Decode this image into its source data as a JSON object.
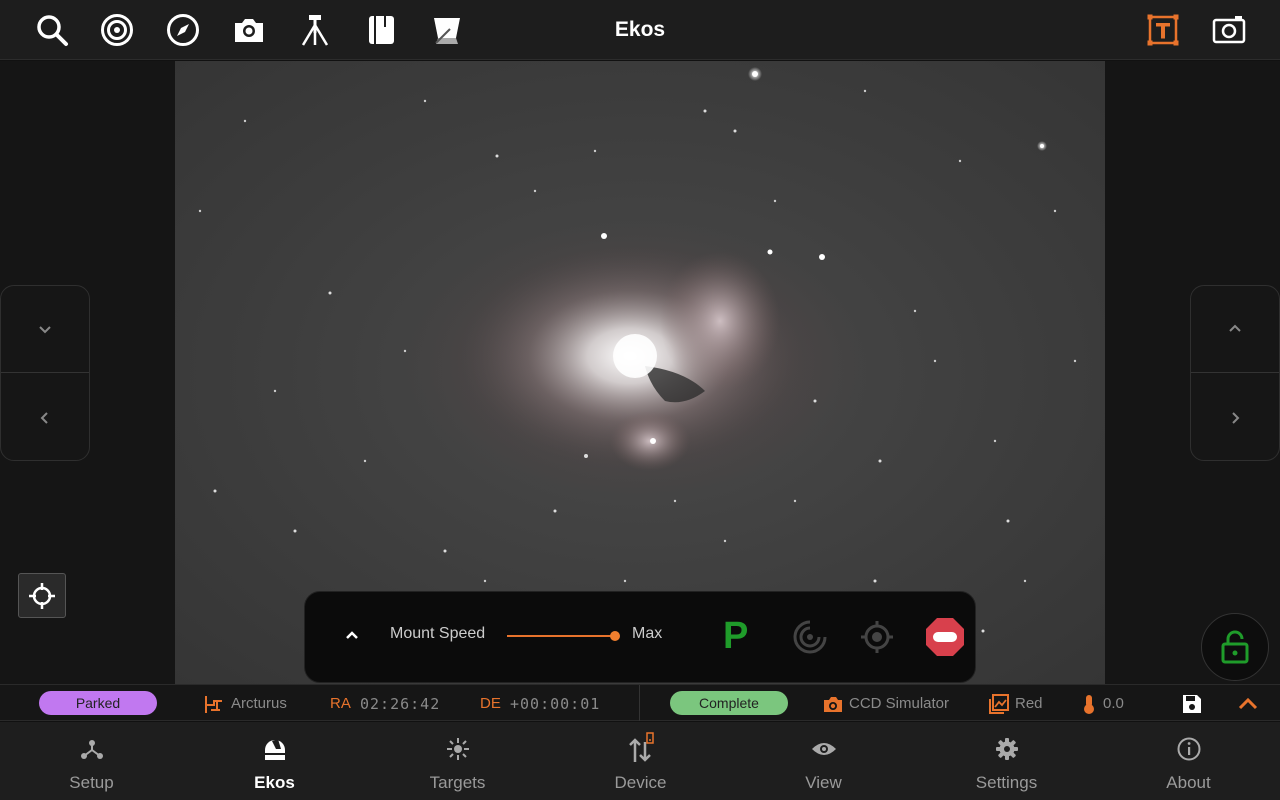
{
  "app": {
    "title": "Ekos"
  },
  "toolbar": {
    "icons": [
      "search-icon",
      "target-icon",
      "compass-icon",
      "camera-icon",
      "tripod-icon",
      "notebook-icon",
      "flat-field-icon",
      "text-overlay-icon",
      "screenshot-icon"
    ],
    "active_color": "#e8732c"
  },
  "mount_panel": {
    "label": "Mount Speed",
    "speed_value": "Max",
    "speed_fraction": 1.0,
    "park_label": "P",
    "park_color": "#1f9c2a",
    "stop_color": "#d8404c"
  },
  "status": {
    "mount_state": "Parked",
    "mount_state_color": "#c178f0",
    "target_name": "Arcturus",
    "ra_label": "RA",
    "ra_value": "02:26:42",
    "de_label": "DE",
    "de_value": "+00:00:01",
    "capture_state": "Complete",
    "capture_state_color": "#7bc67e",
    "camera_name": "CCD Simulator",
    "filter_name": "Red",
    "temperature": "0.0",
    "accent_color": "#e8732c"
  },
  "nav": {
    "items": [
      {
        "label": "Setup",
        "icon": "setup-icon"
      },
      {
        "label": "Ekos",
        "icon": "ekos-dome-icon",
        "active": true
      },
      {
        "label": "Targets",
        "icon": "targets-icon"
      },
      {
        "label": "Device",
        "icon": "device-icon"
      },
      {
        "label": "View",
        "icon": "view-icon"
      },
      {
        "label": "Settings",
        "icon": "settings-icon"
      },
      {
        "label": "About",
        "icon": "about-icon"
      }
    ]
  }
}
